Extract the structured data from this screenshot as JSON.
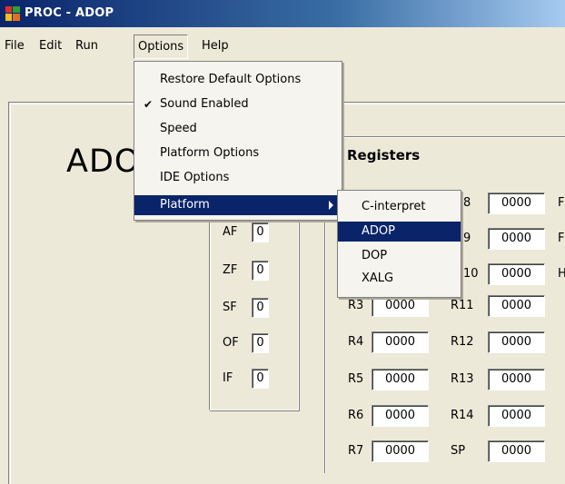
{
  "window": {
    "title": "PROC - ADOP"
  },
  "menubar": {
    "items": [
      "File",
      "Edit",
      "Run",
      "Options",
      "Help"
    ]
  },
  "options_menu": {
    "items": [
      {
        "label": "Restore Default Options",
        "checked": false
      },
      {
        "label": "Sound Enabled",
        "checked": true
      },
      {
        "label": "Speed",
        "checked": false
      },
      {
        "label": "Platform Options",
        "checked": false
      },
      {
        "label": "IDE Options",
        "checked": false
      },
      {
        "label": "Platform",
        "checked": false,
        "submenu": true
      }
    ],
    "check_glyph": "✔"
  },
  "platform_submenu": {
    "items": [
      "C-interpret",
      "ADOP",
      "DOP",
      "XALG"
    ],
    "selected": "ADOP"
  },
  "main": {
    "big_label": "ADO"
  },
  "flags": [
    {
      "name": "AF",
      "value": "0"
    },
    {
      "name": "ZF",
      "value": "0"
    },
    {
      "name": "SF",
      "value": "0"
    },
    {
      "name": "OF",
      "value": "0"
    },
    {
      "name": "IF",
      "value": "0"
    }
  ],
  "registers": {
    "title": "Registers",
    "left": [
      {
        "name": "R3",
        "value": "0000"
      },
      {
        "name": "R4",
        "value": "0000"
      },
      {
        "name": "R5",
        "value": "0000"
      },
      {
        "name": "R6",
        "value": "0000"
      },
      {
        "name": "R7",
        "value": "0000"
      }
    ],
    "right": [
      {
        "name": "8",
        "value": "0000"
      },
      {
        "name": "9",
        "value": "0000"
      },
      {
        "name": "10",
        "value": "0000"
      },
      {
        "name": "R11",
        "value": "0000"
      },
      {
        "name": "R12",
        "value": "0000"
      },
      {
        "name": "R13",
        "value": "0000"
      },
      {
        "name": "R14",
        "value": "0000"
      },
      {
        "name": "SP",
        "value": "0000"
      }
    ],
    "edge_labels": [
      "F",
      "F",
      "H"
    ]
  },
  "colors": {
    "highlight": "#0a246a",
    "title_bar": "#0a246a",
    "window_bg": "#ece9d8"
  }
}
